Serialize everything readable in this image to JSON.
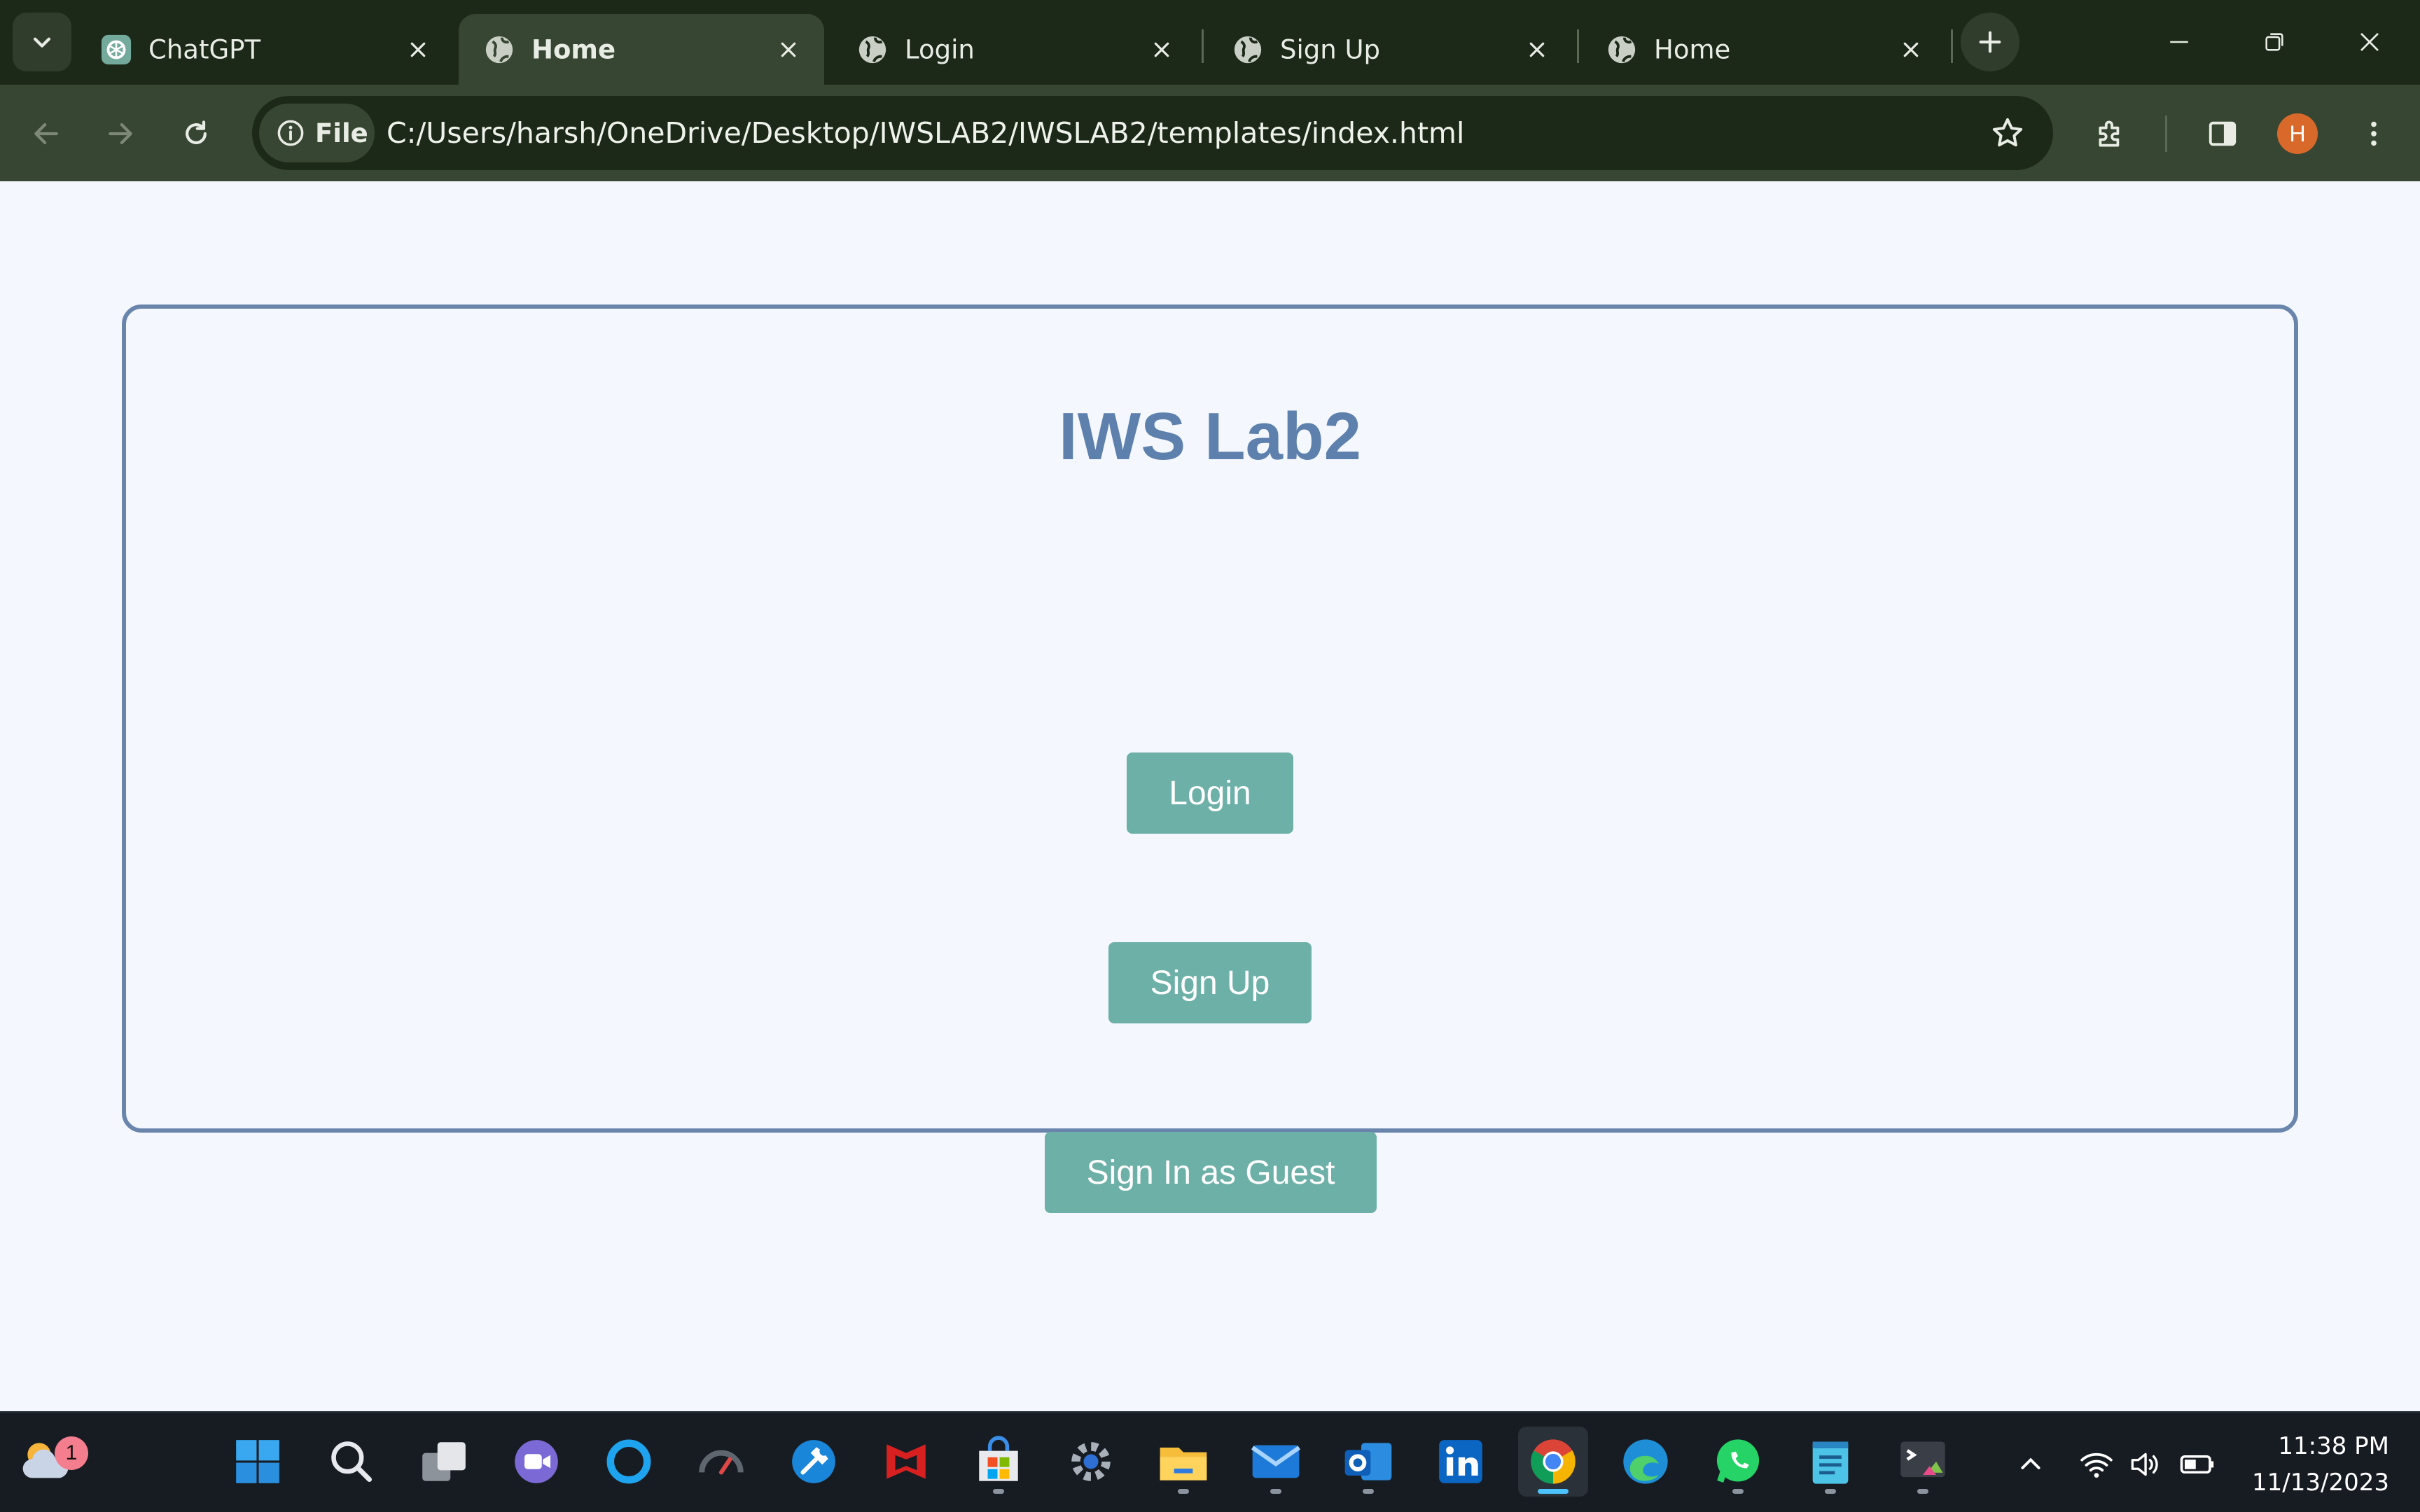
{
  "browser": {
    "tabs": [
      {
        "title": "ChatGPT",
        "favicon": "chatgpt-icon",
        "active": false
      },
      {
        "title": "Home",
        "favicon": "globe-icon",
        "active": true
      },
      {
        "title": "Login",
        "favicon": "globe-icon",
        "active": false
      },
      {
        "title": "Sign Up",
        "favicon": "globe-icon",
        "active": false
      },
      {
        "title": "Home",
        "favicon": "globe-icon",
        "active": false
      }
    ],
    "address": {
      "scheme_label": "File",
      "url": "C:/Users/harsh/OneDrive/Desktop/IWSLAB2/IWSLAB2/templates/index.html"
    },
    "profile_initial": "H"
  },
  "page": {
    "heading": "IWS Lab2",
    "buttons": {
      "login": "Login",
      "signup": "Sign Up",
      "guest": "Sign In as Guest"
    },
    "colors": {
      "background": "#f4f8fe",
      "card_border": "#6a85ac",
      "heading": "#5e80ad",
      "button": "#6db0a8"
    }
  },
  "taskbar": {
    "weather_badge": "1",
    "apps": [
      "windows-start-icon",
      "search-icon",
      "task-view-icon",
      "teams-icon",
      "cortana-icon",
      "speedometer-icon",
      "settings-tool-icon",
      "mcafee-icon",
      "microsoft-store-icon",
      "settings-icon",
      "file-explorer-icon",
      "mail-icon",
      "outlook-icon",
      "linkedin-icon",
      "chrome-icon",
      "edge-icon",
      "whatsapp-icon",
      "notepad-icon",
      "terminal-icon"
    ],
    "time": "11:38 PM",
    "date": "11/13/2023"
  }
}
